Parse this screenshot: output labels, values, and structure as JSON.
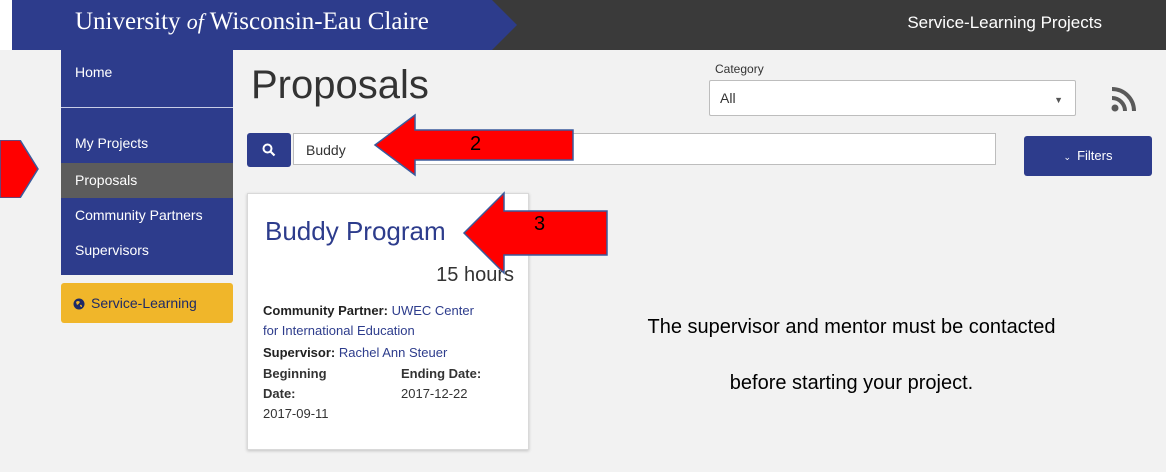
{
  "header": {
    "university_prefix": "University ",
    "university_of": "of",
    "university_suffix": " Wisconsin-Eau Claire",
    "site_title": "Service-Learning Projects"
  },
  "sidebar": {
    "home": "Home",
    "items": [
      {
        "label": "My Projects"
      },
      {
        "label": "Proposals"
      },
      {
        "label": "Community Partners"
      },
      {
        "label": "Supervisors"
      }
    ],
    "service_button": "Service-Learning"
  },
  "main": {
    "title": "Proposals",
    "category": {
      "label": "Category",
      "selected": "All"
    },
    "search": {
      "value": "Buddy"
    },
    "filters_label": "Filters"
  },
  "card": {
    "title": "Buddy Program",
    "hours": "15 hours",
    "partner_label": "Community Partner:",
    "partner_value_line1": "UWEC Center",
    "partner_value_line2": "for International Education",
    "supervisor_label": "Supervisor:",
    "supervisor_value": "Rachel Ann Steuer",
    "begin_label_1": "Beginning",
    "begin_label_2": "Date:",
    "begin_value": "2017-09-11",
    "end_label": "Ending Date:",
    "end_value": "2017-12-22"
  },
  "annotations": {
    "arrow2_num": "2",
    "arrow3_num": "3",
    "note_line1": "The supervisor and mentor must be contacted",
    "note_line2": "before starting your project."
  },
  "colors": {
    "brand_blue": "#2d3c8c",
    "header_dark": "#3a3a3a",
    "active_item": "#5c5c5c",
    "gold": "#f0b62a",
    "arrow_red": "#ff0000"
  },
  "icons": {
    "search": "search-icon",
    "rss": "rss-icon",
    "globe": "globe-icon",
    "caret": "chevron-down-icon"
  }
}
